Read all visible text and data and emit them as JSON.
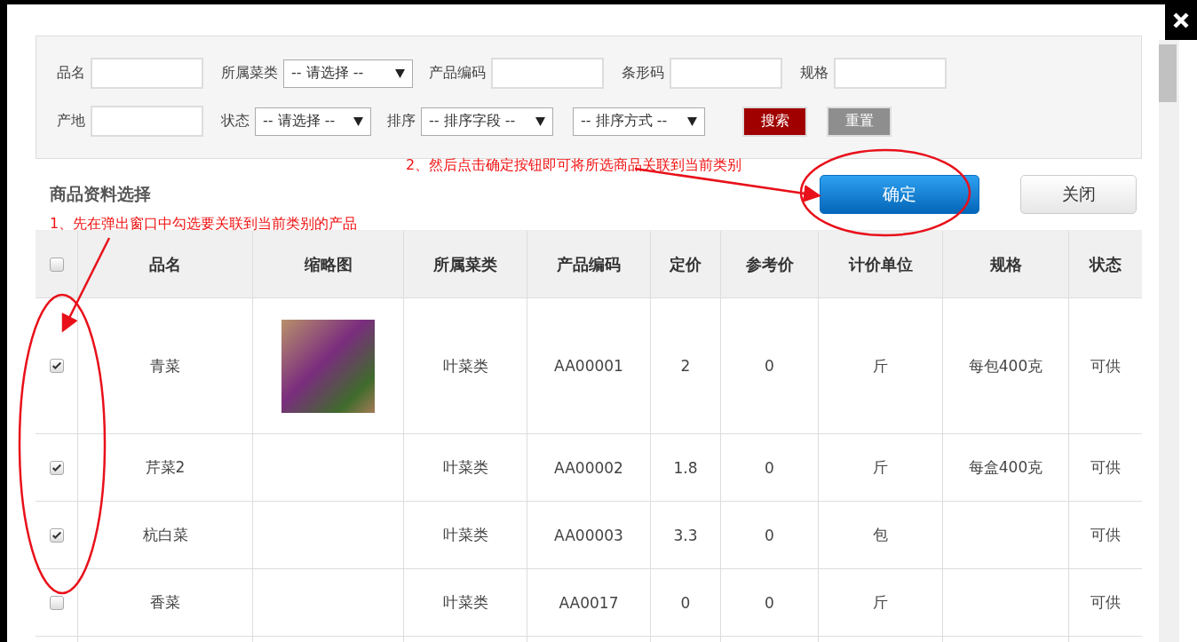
{
  "filters": {
    "rows": [
      [
        {
          "kind": "text",
          "label": "品名"
        },
        {
          "kind": "select",
          "label": "所属菜类",
          "value": "-- 请选择 --"
        },
        {
          "kind": "text",
          "label": "产品编码"
        },
        {
          "kind": "text",
          "label": "条形码"
        },
        {
          "kind": "text",
          "label": "规格"
        }
      ],
      [
        {
          "kind": "text",
          "label": "产地"
        },
        {
          "kind": "select",
          "label": "状态",
          "value": "-- 请选择 --"
        },
        {
          "kind": "select",
          "label": "排序",
          "value": "-- 排序字段 --"
        },
        {
          "kind": "select",
          "value": "-- 排序方式 --"
        },
        {
          "kind": "button",
          "label": "搜索"
        },
        {
          "kind": "button",
          "label": "重置"
        }
      ]
    ]
  },
  "section_title": "商品资料选择",
  "buttons": [
    {
      "label": "确定"
    },
    {
      "label": "关闭"
    }
  ],
  "annotations": [
    {
      "text": "2、然后点击确定按钮即可将所选商品关联到当前类别"
    },
    {
      "text": "1、先在弹出窗口中勾选要关联到当前类别的产品"
    }
  ],
  "table": {
    "select_all": {
      "checked": false
    },
    "columns": [
      "品名",
      "缩略图",
      "所属菜类",
      "产品编码",
      "定价",
      "参考价",
      "计价单位",
      "规格",
      "状态"
    ],
    "rows": [
      {
        "checked": true,
        "has_thumbnail": true,
        "name": "青菜",
        "category": "叶菜类",
        "code": "AA00001",
        "price": "2",
        "ref_price": "0",
        "unit": "斤",
        "spec": "每包400克",
        "status": "可供"
      },
      {
        "checked": true,
        "has_thumbnail": false,
        "name": "芹菜2",
        "category": "叶菜类",
        "code": "AA00002",
        "price": "1.8",
        "ref_price": "0",
        "unit": "斤",
        "spec": "每盒400克",
        "status": "可供"
      },
      {
        "checked": true,
        "has_thumbnail": false,
        "name": "杭白菜",
        "category": "叶菜类",
        "code": "AA00003",
        "price": "3.3",
        "ref_price": "0",
        "unit": "包",
        "status": "可供"
      },
      {
        "checked": false,
        "has_thumbnail": false,
        "name": "香菜",
        "category": "叶菜类",
        "code": "AA0017",
        "price": "0",
        "ref_price": "0",
        "unit": "斤",
        "status": "可供"
      }
    ]
  }
}
